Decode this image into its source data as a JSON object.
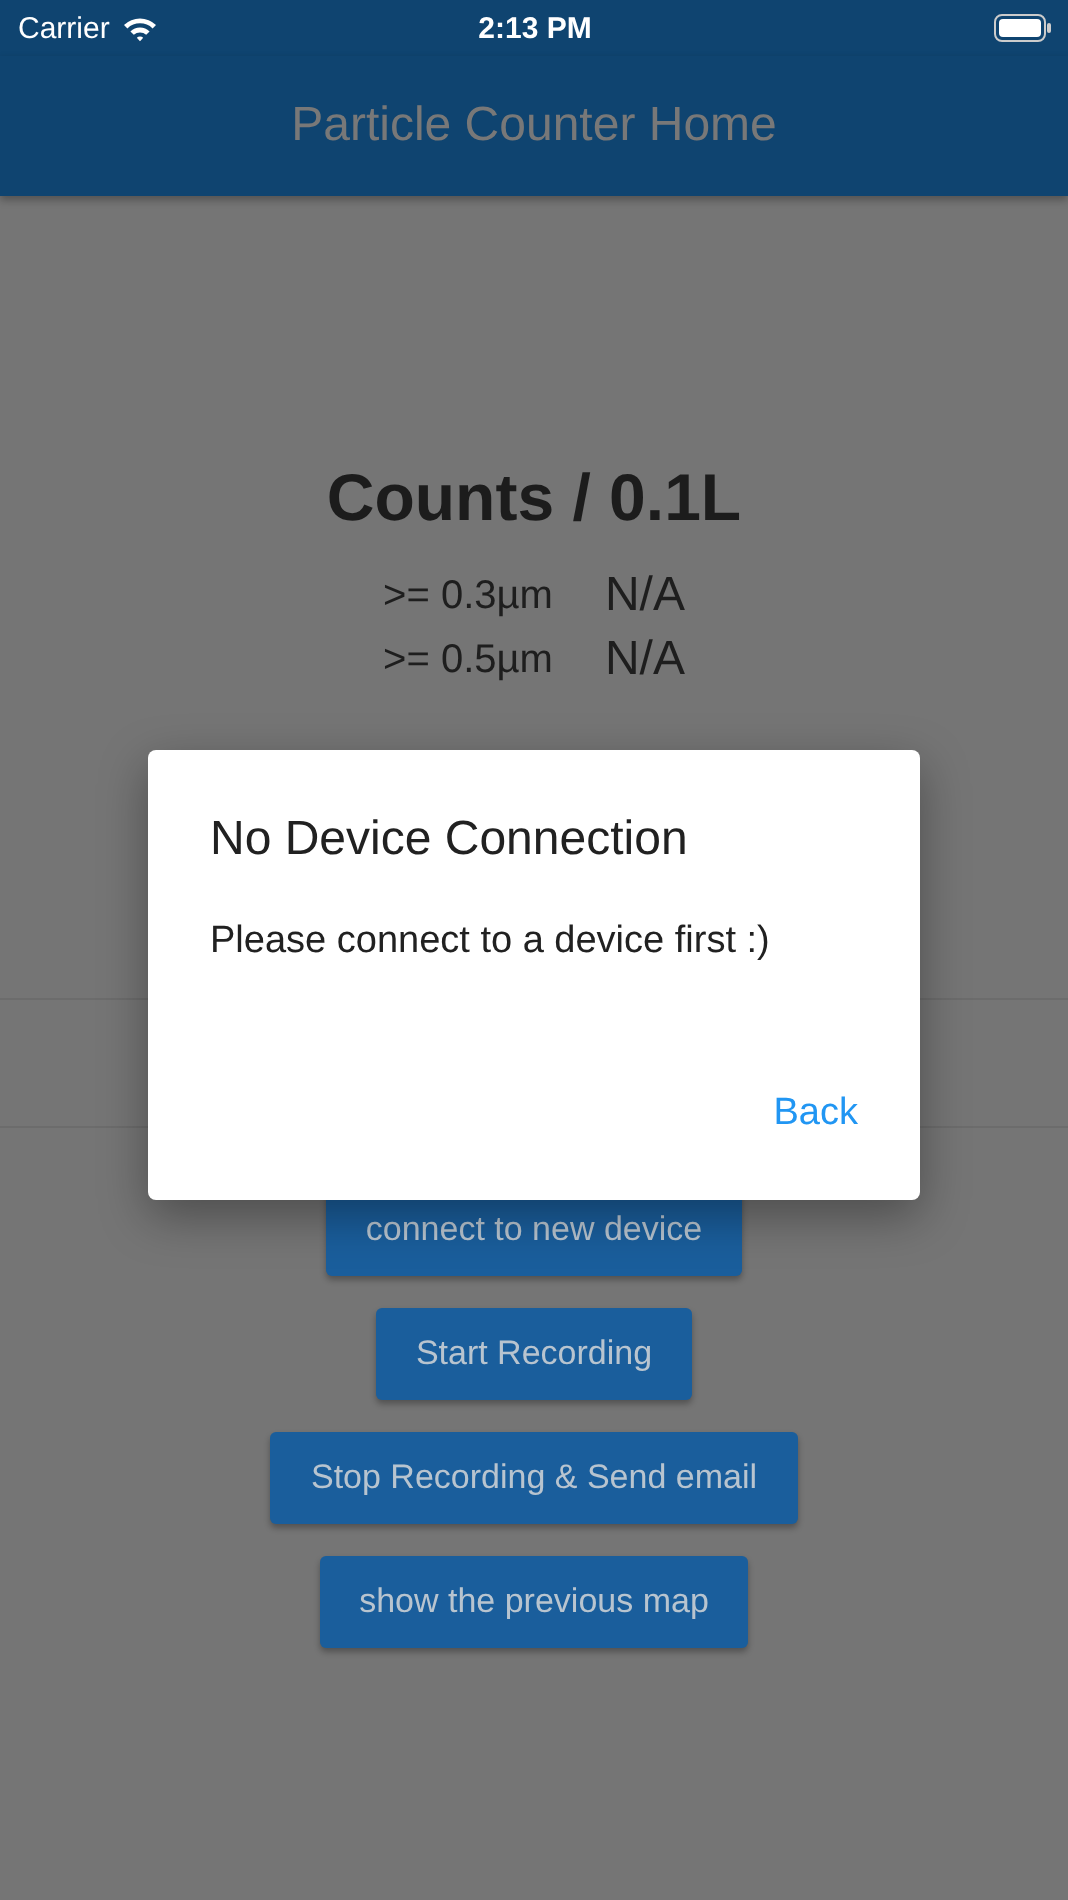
{
  "status_bar": {
    "carrier": "Carrier",
    "time": "2:13 PM"
  },
  "app_bar": {
    "title": "Particle Counter Home"
  },
  "counts": {
    "title": "Counts / 0.1L",
    "rows": [
      {
        "size": ">= 0.3µm",
        "value": "N/A"
      },
      {
        "size": ">= 0.5µm",
        "value": "N/A"
      }
    ]
  },
  "buttons": [
    "connect to new device",
    "Start Recording",
    "Stop Recording & Send email",
    "show the previous map"
  ],
  "dialog": {
    "title": "No Device Connection",
    "message": "Please connect to a device first :)",
    "action": "Back"
  }
}
